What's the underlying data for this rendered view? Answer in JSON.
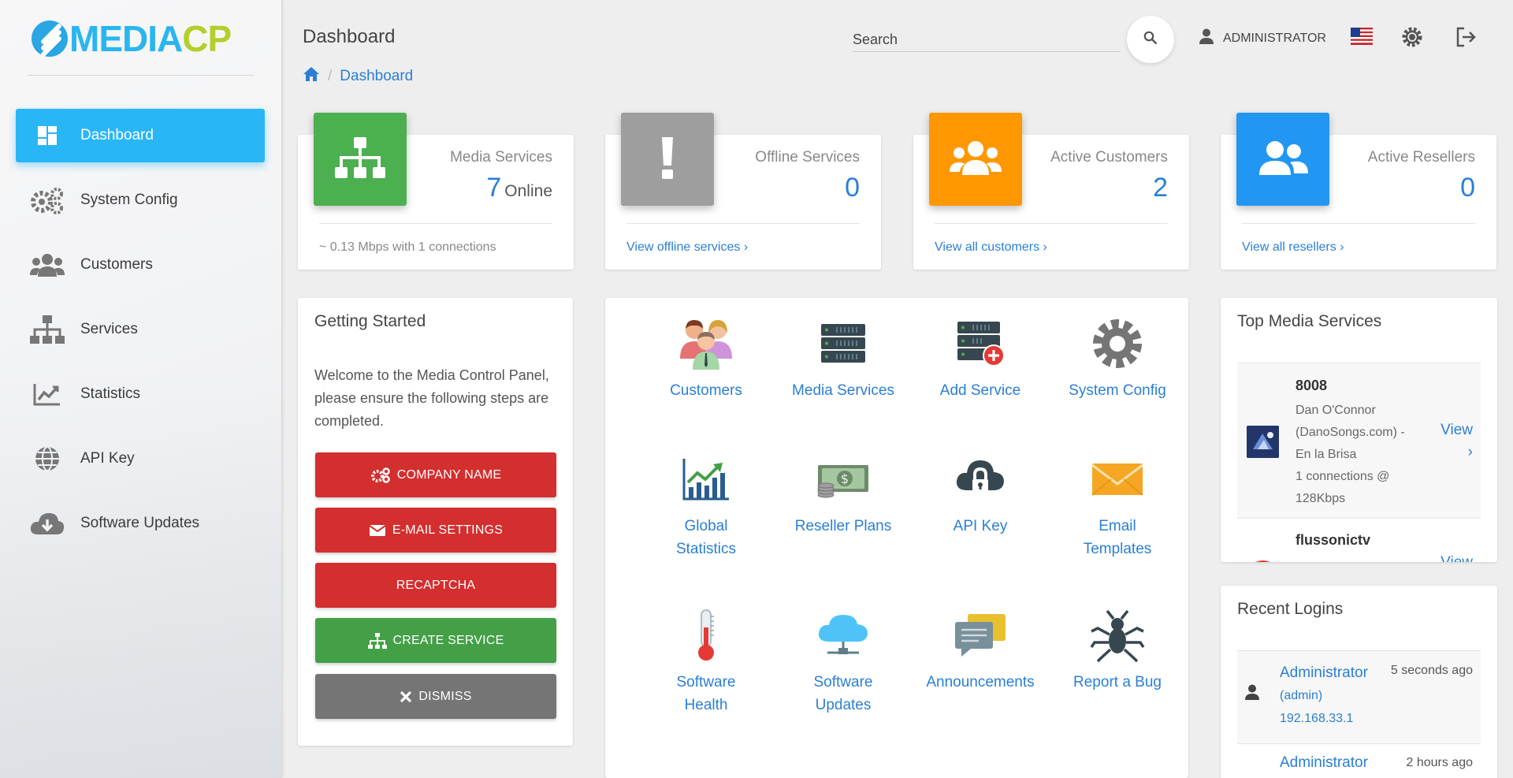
{
  "brand": {
    "logo_part1": "MEDIA",
    "logo_part2": "CP",
    "primary": "#29b6f6",
    "accent": "#b3cf2c"
  },
  "sidebar": {
    "items": [
      {
        "label": "Dashboard",
        "icon": "dashboard-icon",
        "active": true
      },
      {
        "label": "System Config",
        "icon": "cogs-icon"
      },
      {
        "label": "Customers",
        "icon": "users-icon"
      },
      {
        "label": "Services",
        "icon": "sitemap-icon"
      },
      {
        "label": "Statistics",
        "icon": "chart-icon"
      },
      {
        "label": "API Key",
        "icon": "globe-icon"
      },
      {
        "label": "Software Updates",
        "icon": "cloud-download-icon"
      }
    ]
  },
  "header": {
    "title": "Dashboard",
    "breadcrumb": {
      "current": "Dashboard"
    },
    "search": {
      "placeholder": "Search"
    },
    "user": "ADMINISTRATOR"
  },
  "stats": [
    {
      "label": "Media Services",
      "value": "7",
      "unit": "Online",
      "footer": "~ 0.13 Mbps with 1 connections",
      "color": "#4caf50"
    },
    {
      "label": "Offline Services",
      "value": "0",
      "footer": "View offline services",
      "color": "#9e9e9e"
    },
    {
      "label": "Active Customers",
      "value": "2",
      "footer": "View all customers",
      "color": "#ff9800"
    },
    {
      "label": "Active Resellers",
      "value": "0",
      "footer": "View all resellers",
      "color": "#2196f3"
    }
  ],
  "getting_started": {
    "title": "Getting Started",
    "intro": "Welcome to the Media Control Panel, please ensure the following steps are completed.",
    "buttons": [
      {
        "label": "COMPANY NAME",
        "color": "red"
      },
      {
        "label": "E-MAIL SETTINGS",
        "color": "red"
      },
      {
        "label": "RECAPTCHA",
        "color": "red"
      },
      {
        "label": "CREATE SERVICE",
        "color": "green"
      },
      {
        "label": "DISMISS",
        "color": "grey"
      }
    ]
  },
  "quick_links": [
    {
      "line1": "Customers",
      "line2": ""
    },
    {
      "line1": "Media Services",
      "line2": ""
    },
    {
      "line1": "Add Service",
      "line2": ""
    },
    {
      "line1": "System Config",
      "line2": ""
    },
    {
      "line1": "Global",
      "line2": "Statistics"
    },
    {
      "line1": "Reseller Plans",
      "line2": ""
    },
    {
      "line1": "API Key",
      "line2": ""
    },
    {
      "line1": "Email",
      "line2": "Templates"
    },
    {
      "line1": "Software",
      "line2": "Health"
    },
    {
      "line1": "Software",
      "line2": "Updates"
    },
    {
      "line1": "Announcements",
      "line2": ""
    },
    {
      "line1": "Report a Bug",
      "line2": ""
    }
  ],
  "top_media_services": {
    "title": "Top Media Services",
    "items": [
      {
        "name": "8008",
        "description": "Dan O'Connor (DanoSongs.com) - En la Brisa",
        "stats": "1 connections @ 128Kbps",
        "action": "View"
      },
      {
        "name": "flussonictv",
        "action": "View"
      }
    ]
  },
  "recent_logins": {
    "title": "Recent Logins",
    "items": [
      {
        "user": "Administrator",
        "role": "(admin)",
        "ip": "192.168.33.1",
        "time": "5 seconds ago"
      },
      {
        "user": "Administrator",
        "time": "2 hours ago"
      }
    ]
  }
}
